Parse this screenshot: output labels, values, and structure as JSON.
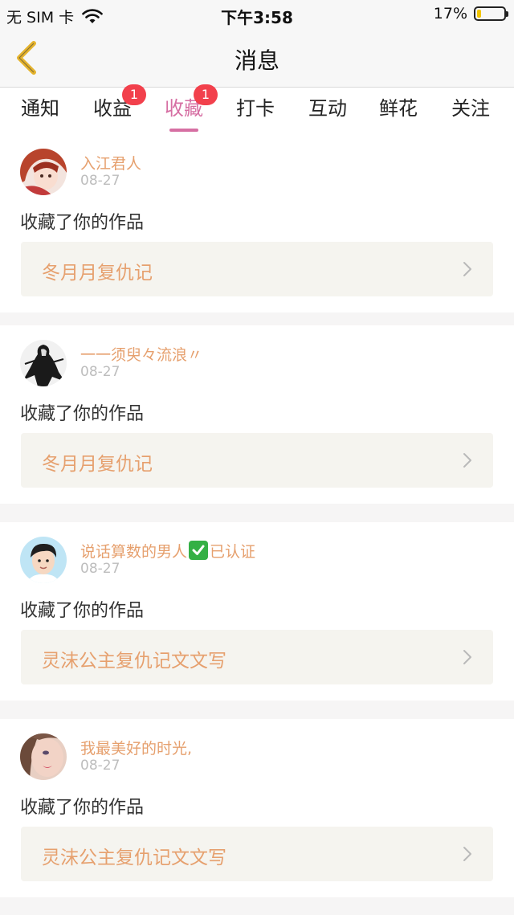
{
  "status_bar": {
    "carrier": "无 SIM 卡",
    "time": "下午3:58",
    "battery_percent": "17%",
    "battery_level": 0.17,
    "battery_color": "#f2c500"
  },
  "nav": {
    "title": "消息",
    "back_icon": "chevron-left-icon",
    "back_color": "#e5b32d"
  },
  "tabs": [
    {
      "label": "通知",
      "badge": null,
      "active": false
    },
    {
      "label": "收益",
      "badge": "1",
      "active": false
    },
    {
      "label": "收藏",
      "badge": "1",
      "active": true
    },
    {
      "label": "打卡",
      "badge": null,
      "active": false
    },
    {
      "label": "互动",
      "badge": null,
      "active": false
    },
    {
      "label": "鲜花",
      "badge": null,
      "active": false
    },
    {
      "label": "关注",
      "badge": null,
      "active": false
    }
  ],
  "accent_color": "#d66fa3",
  "badge_color": "#f2404c",
  "items": [
    {
      "username": "入江君人",
      "verified_suffix": "",
      "date": "08-27",
      "action": "收藏了你的作品",
      "work_title": "冬月月复仇记",
      "avatar": "avatar-anime-girl"
    },
    {
      "username": "一一须臾々流浪〃",
      "verified_suffix": "",
      "date": "08-27",
      "action": "收藏了你的作品",
      "work_title": "冬月月复仇记",
      "avatar": "avatar-ink-figure"
    },
    {
      "username": "说话算数的男人",
      "verified_suffix": "已认证",
      "date": "08-27",
      "action": "收藏了你的作品",
      "work_title": "灵沫公主复仇记文文写",
      "avatar": "avatar-cartoon-boy"
    },
    {
      "username": "我最美好的时光,",
      "verified_suffix": "",
      "date": "08-27",
      "action": "收藏了你的作品",
      "work_title": "灵沫公主复仇记文文写",
      "avatar": "avatar-girl-face"
    }
  ]
}
